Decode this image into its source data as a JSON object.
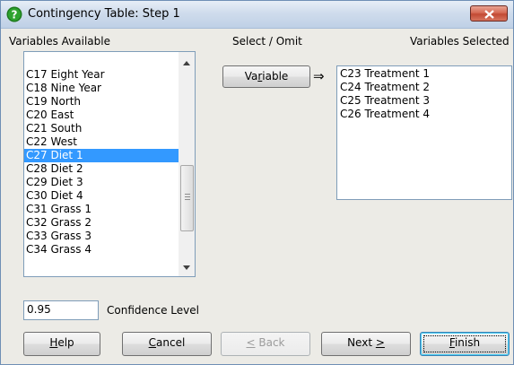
{
  "window": {
    "title": "Contingency Table: Step 1"
  },
  "labels": {
    "variables_available": "Variables Available",
    "select_omit": "Select / Omit",
    "variables_selected": "Variables Selected",
    "confidence_level": "Confidence Level"
  },
  "variable_button": {
    "pre": "Va",
    "mnemonic": "r",
    "post": "iable"
  },
  "arrow": "⇒",
  "available": {
    "items": [
      "C17 Eight Year",
      "C18 Nine Year",
      "C19 North",
      "C20 East",
      "C21 South",
      "C22 West",
      "C27 Diet 1",
      "C28 Diet 2",
      "C29 Diet 3",
      "C30 Diet 4",
      "C31 Grass 1",
      "C32 Grass 2",
      "C33 Grass 3",
      "C34 Grass 4"
    ],
    "selected": "C27 Diet 1"
  },
  "selected_list": {
    "items": [
      "C23 Treatment 1",
      "C24 Treatment 2",
      "C25 Treatment 3",
      "C26 Treatment 4"
    ]
  },
  "confidence": {
    "value": "0.95"
  },
  "buttons": {
    "help": {
      "mnemonic": "H",
      "post": "elp"
    },
    "cancel": {
      "mnemonic": "C",
      "post": "ancel"
    },
    "back": {
      "mnemonic": "<",
      "post": " Back"
    },
    "next": {
      "pre": "Next ",
      "mnemonic": ">"
    },
    "finish": {
      "mnemonic": "F",
      "post": "inish"
    }
  },
  "colors": {
    "selection": "#3399ff",
    "close_button": "#c24a34"
  }
}
